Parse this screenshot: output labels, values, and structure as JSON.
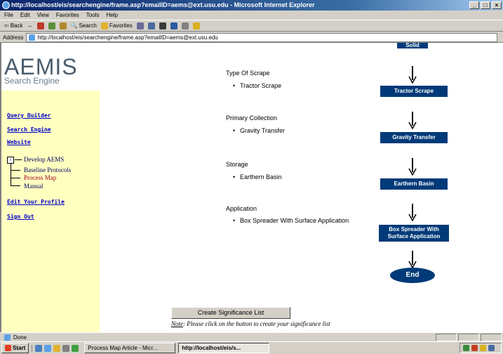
{
  "window": {
    "title": "http://localhost/eis/searchengine/frame.asp?emailID=aems@ext.usu.edu - Microsoft Internet Explorer"
  },
  "menu": [
    "File",
    "Edit",
    "View",
    "Favorites",
    "Tools",
    "Help"
  ],
  "toolbar": {
    "back": "Back",
    "search": "Search",
    "favorites": "Favorites"
  },
  "address": {
    "label": "Address",
    "url": "http://localhost/eis/searchengine/frame.asp?emailID=aems@ext.usu.edu"
  },
  "sidebar": {
    "logo": "AEMIS",
    "logo_sub": "Search Engine",
    "links": [
      "Query Builder",
      "Search Engine",
      "Website"
    ],
    "tree": {
      "toggle": "-",
      "root": "Develop AEMS",
      "children": [
        "Baseline Protocols",
        "Process Map",
        "Manual"
      ]
    },
    "links2": [
      "Edit Your Profile",
      "Sign Out"
    ]
  },
  "sections": [
    {
      "title": "Type Of Scrape",
      "item": "Tractor Scrape"
    },
    {
      "title": "Primary Collection",
      "item": "Gravity Transfer"
    },
    {
      "title": "Storage",
      "item": "Earthern Basin"
    },
    {
      "title": "Application",
      "item": "Box Spreader With Surface Application"
    }
  ],
  "flow": {
    "top_partial": "Solid",
    "boxes": [
      "Tractor Scrape",
      "Gravity Transfer",
      "Earthern Basin",
      "Box Spreader With Surface Application"
    ],
    "end": "End"
  },
  "button": {
    "significance": "Create Significance List"
  },
  "note": {
    "label": "Note",
    "text": ": Please click on the button to create your significance list"
  },
  "status": {
    "text": "Done"
  },
  "taskbar": {
    "start": "Start",
    "items": [
      "Process Map Article - Micr...",
      "http://localhost/eis/s..."
    ]
  },
  "colors": {
    "flow_box": "#003a78",
    "sidebar_bg": "#ffffc0",
    "link": "#0000cc"
  }
}
